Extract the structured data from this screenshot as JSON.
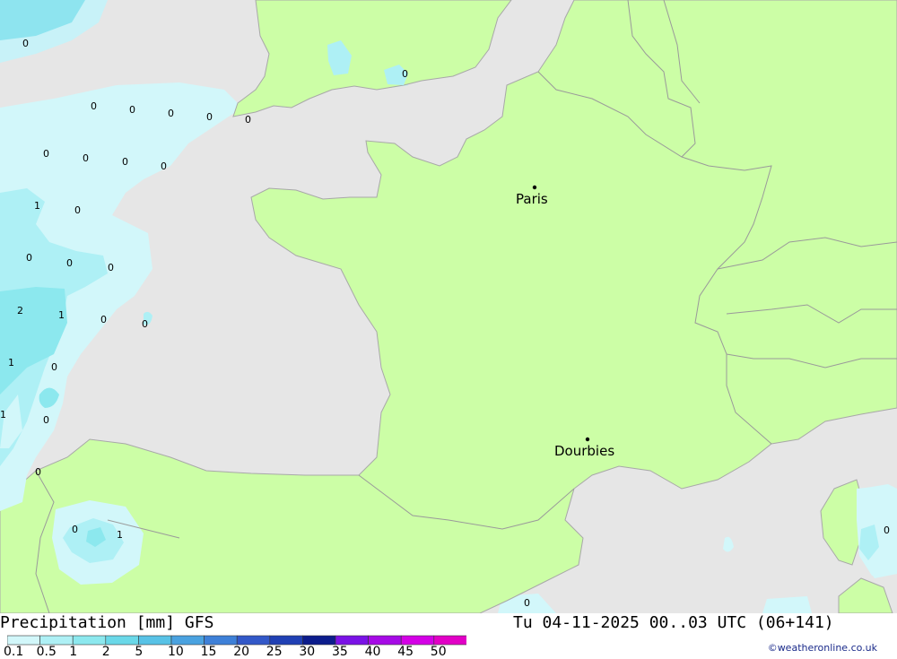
{
  "title": "Precipitation [mm] GFS",
  "datetime": "Tu 04-11-2025 00..03 UTC (06+141)",
  "credit": "©weatheronline.co.uk",
  "cities": [
    {
      "name": "Paris"
    },
    {
      "name": "Dourbies"
    }
  ],
  "map_values": [
    "0",
    "0",
    "0",
    "0",
    "0",
    "0",
    "0",
    "0",
    "0",
    "0",
    "0",
    "1",
    "0",
    "0",
    "0",
    "0",
    "2",
    "1",
    "0",
    "0",
    "1",
    "0",
    "1",
    "0",
    "0",
    "0",
    "1",
    "0",
    "0",
    "0"
  ],
  "legend": {
    "labels": [
      "0.1",
      "0.5",
      "1",
      "2",
      "5",
      "10",
      "15",
      "20",
      "25",
      "30",
      "35",
      "40",
      "45",
      "50"
    ],
    "colors": [
      "#d2f7fa",
      "#aef0f5",
      "#8ce8ee",
      "#6ad8e8",
      "#58c2e6",
      "#4aa2e0",
      "#3e80d8",
      "#3258c8",
      "#2040b4",
      "#0c1c8c",
      "#7a12e6",
      "#a60ae6",
      "#d400e6",
      "#e200c6",
      "#c800a8"
    ]
  },
  "colors": {
    "sea": "#e6e6e6",
    "land": "#ccfea6",
    "border": "#9a9a9a"
  }
}
